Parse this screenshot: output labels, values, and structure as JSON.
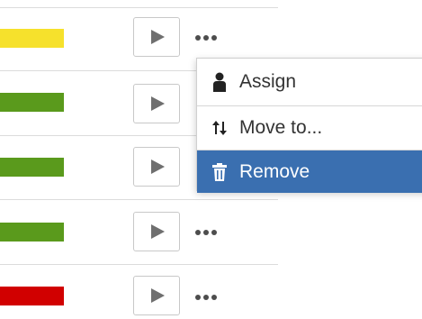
{
  "rows": [
    {
      "status_color": "#f6e12c"
    },
    {
      "status_color": "#5a9a1c"
    },
    {
      "status_color": "#5a9a1c"
    },
    {
      "status_color": "#5a9a1c"
    },
    {
      "status_color": "#d10000"
    }
  ],
  "icons": {
    "play": "play-icon",
    "more": "more-icon",
    "assign": "person-icon",
    "move": "swap-arrows-icon",
    "remove": "trash-icon"
  },
  "menu": {
    "items": [
      {
        "label": "Assign"
      },
      {
        "label": "Move to..."
      },
      {
        "label": "Remove",
        "highlighted": true
      }
    ]
  },
  "colors": {
    "highlight": "#3a6fb0",
    "border": "#dcdcdc"
  }
}
